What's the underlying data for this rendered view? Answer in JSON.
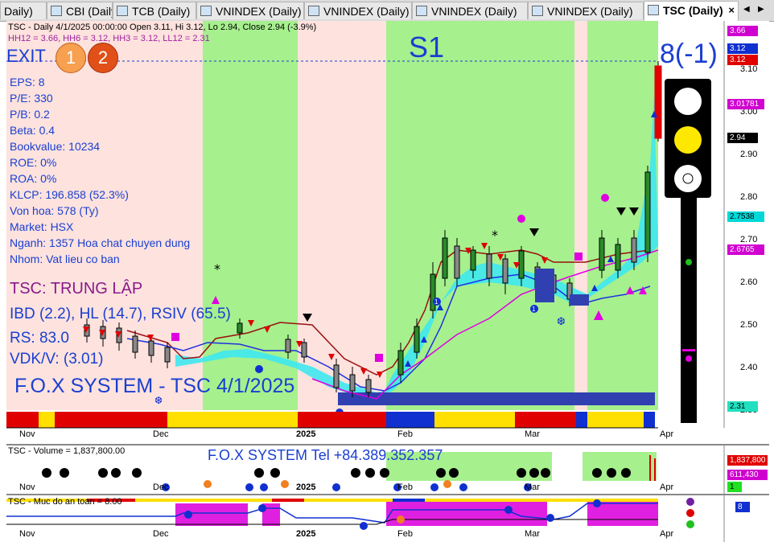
{
  "tabs": [
    {
      "label": "Daily)",
      "active": false
    },
    {
      "label": "CBI (Daily)",
      "active": false
    },
    {
      "label": "TCB (Daily)",
      "active": false
    },
    {
      "label": "VNINDEX (Daily)",
      "active": false
    },
    {
      "label": "VNINDEX (Daily)",
      "active": false
    },
    {
      "label": "VNINDEX (Daily)",
      "active": false
    },
    {
      "label": "VNINDEX (Daily)",
      "active": false
    },
    {
      "label": "TSC (Daily)",
      "active": true
    }
  ],
  "main": {
    "header": "TSC - Daily 4/1/2025 00:00:00 Open 3.11, Hi 3.12, Lo 2.94, Close 2.94 (-3.9%)",
    "hh_line": "HH12 = 3.66, HH6 = 3.12, HH3 = 3.12, LL12 = 2.31",
    "exit_label": "EXIT",
    "exit_circles": [
      "1",
      "2"
    ],
    "signal": "S1",
    "count": "8(-1)",
    "fundamentals": [
      "EPS: 8",
      "P/E: 330",
      "P/B: 0.2",
      "Beta: 0.4",
      "Bookvalue: 10234",
      "ROE: 0%",
      "ROA: 0%",
      "KLCP: 196.858 (52.3%)",
      "Von hoa: 578 (Ty)",
      "Market: HSX",
      "Nganh: 1357 Hoa chat chuyen dung",
      "Nhom: Vat lieu co ban"
    ],
    "trend": "TSC: TRUNG LẬP",
    "ibd": "IBD (2.2), HL (14.7), RSIV (65.5)",
    "rs": "RS: 83.0",
    "vdkv": "VDK/V:  (3.01)",
    "fox_title": "F.O.X SYSTEM - TSC 4/1/2025",
    "price_ticks": [
      "3.10",
      "3.00",
      "2.90",
      "2.80",
      "2.70",
      "2.60",
      "2.50",
      "2.40",
      "2.30"
    ],
    "price_badges": [
      {
        "text": "3.66",
        "bg": "#d000d0",
        "fg": "#ffffff"
      },
      {
        "text": "3.12",
        "bg": "#1030d0",
        "fg": "#ffffff"
      },
      {
        "text": "3.12",
        "bg": "#e00000",
        "fg": "#ffffff"
      },
      {
        "text": "3.01781",
        "bg": "#d000d0",
        "fg": "#ffffff"
      },
      {
        "text": "2.94",
        "bg": "#000000",
        "fg": "#ffffff"
      },
      {
        "text": "2.7538",
        "bg": "#00d8d8",
        "fg": "#000000"
      },
      {
        "text": "2.6765",
        "bg": "#d000d0",
        "fg": "#ffffff"
      },
      {
        "text": "2.31",
        "bg": "#20e0c0",
        "fg": "#000000"
      }
    ],
    "x_labels": [
      "Nov",
      "Dec",
      "2025",
      "Feb",
      "Mar",
      "Apr"
    ]
  },
  "volume": {
    "header": "TSC - Volume = 1,837,800.00",
    "tel": "F.O.X SYSTEM Tel +84.389.352.357",
    "badges": [
      {
        "text": "1,837,800",
        "bg": "#e00000",
        "fg": "#ffffff"
      },
      {
        "text": "611,430",
        "bg": "#d000d0",
        "fg": "#ffffff"
      },
      {
        "text": "1",
        "bg": "#20e020",
        "fg": "#000000"
      }
    ],
    "x_labels": [
      "Nov",
      "Dec",
      "2025",
      "Feb",
      "Mar",
      "Apr"
    ]
  },
  "safety": {
    "header": "TSC - Muc do an toan = 8.00",
    "badge": "8",
    "x_labels": [
      "Nov",
      "Dec",
      "2025",
      "Feb",
      "Mar",
      "Apr"
    ]
  },
  "colors": {
    "bg_pink": "#fde2de",
    "bg_green": "#a6f08e",
    "cyan_band": "#3fe8f0",
    "blue": "#1a3fd0",
    "red": "#e00000",
    "magenta": "#e000e0"
  }
}
